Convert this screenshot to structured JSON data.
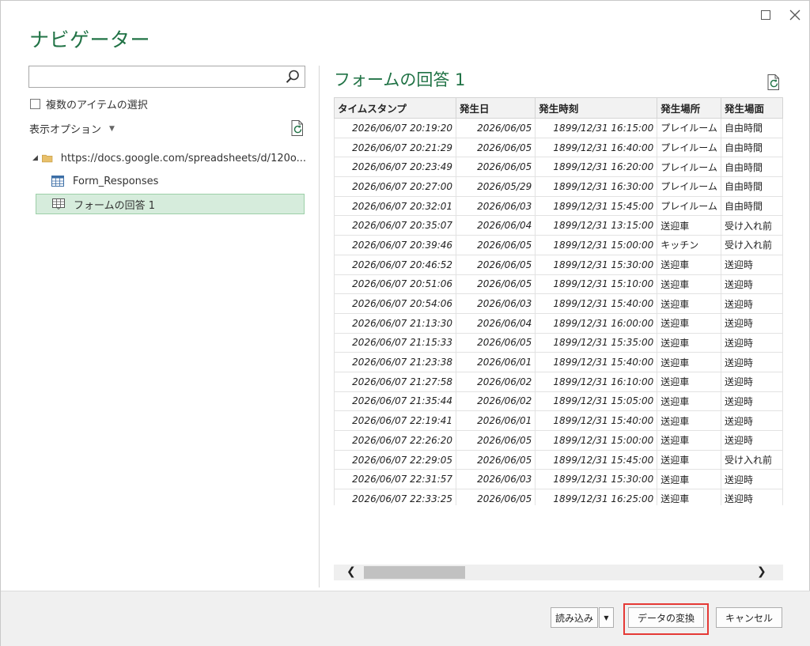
{
  "window": {
    "title": "ナビゲーター"
  },
  "search": {
    "value": "",
    "placeholder": ""
  },
  "left": {
    "multi_select_label": "複数のアイテムの選択",
    "display_options_label": "表示オプション",
    "tree": {
      "root": "https://docs.google.com/spreadsheets/d/120o...",
      "items": [
        {
          "label": "Form_Responses",
          "selected": false
        },
        {
          "label": "フォームの回答 1",
          "selected": true
        }
      ]
    }
  },
  "preview": {
    "title": "フォームの回答 1",
    "columns": [
      "タイムスタンプ",
      "発生日",
      "発生時刻",
      "発生場所",
      "発生場面"
    ],
    "rows": [
      [
        "2026/06/07 20:19:20",
        "2026/06/05",
        "1899/12/31 16:15:00",
        "プレイルーム",
        "自由時間"
      ],
      [
        "2026/06/07 20:21:29",
        "2026/06/05",
        "1899/12/31 16:40:00",
        "プレイルーム",
        "自由時間"
      ],
      [
        "2026/06/07 20:23:49",
        "2026/06/05",
        "1899/12/31 16:20:00",
        "プレイルーム",
        "自由時間"
      ],
      [
        "2026/06/07 20:27:00",
        "2026/05/29",
        "1899/12/31 16:30:00",
        "プレイルーム",
        "自由時間"
      ],
      [
        "2026/06/07 20:32:01",
        "2026/06/03",
        "1899/12/31 15:45:00",
        "プレイルーム",
        "自由時間"
      ],
      [
        "2026/06/07 20:35:07",
        "2026/06/04",
        "1899/12/31 13:15:00",
        "送迎車",
        "受け入れ前"
      ],
      [
        "2026/06/07 20:39:46",
        "2026/06/05",
        "1899/12/31 15:00:00",
        "キッチン",
        "受け入れ前"
      ],
      [
        "2026/06/07 20:46:52",
        "2026/06/05",
        "1899/12/31 15:30:00",
        "送迎車",
        "送迎時"
      ],
      [
        "2026/06/07 20:51:06",
        "2026/06/05",
        "1899/12/31 15:10:00",
        "送迎車",
        "送迎時"
      ],
      [
        "2026/06/07 20:54:06",
        "2026/06/03",
        "1899/12/31 15:40:00",
        "送迎車",
        "送迎時"
      ],
      [
        "2026/06/07 21:13:30",
        "2026/06/04",
        "1899/12/31 16:00:00",
        "送迎車",
        "送迎時"
      ],
      [
        "2026/06/07 21:15:33",
        "2026/06/05",
        "1899/12/31 15:35:00",
        "送迎車",
        "送迎時"
      ],
      [
        "2026/06/07 21:23:38",
        "2026/06/01",
        "1899/12/31 15:40:00",
        "送迎車",
        "送迎時"
      ],
      [
        "2026/06/07 21:27:58",
        "2026/06/02",
        "1899/12/31 16:10:00",
        "送迎車",
        "送迎時"
      ],
      [
        "2026/06/07 21:35:44",
        "2026/06/02",
        "1899/12/31 15:05:00",
        "送迎車",
        "送迎時"
      ],
      [
        "2026/06/07 22:19:41",
        "2026/06/01",
        "1899/12/31 15:40:00",
        "送迎車",
        "送迎時"
      ],
      [
        "2026/06/07 22:26:20",
        "2026/06/05",
        "1899/12/31 15:00:00",
        "送迎車",
        "送迎時"
      ],
      [
        "2026/06/07 22:29:05",
        "2026/06/05",
        "1899/12/31 15:45:00",
        "送迎車",
        "受け入れ前"
      ],
      [
        "2026/06/07 22:31:57",
        "2026/06/03",
        "1899/12/31 15:30:00",
        "送迎車",
        "送迎時"
      ],
      [
        "2026/06/07 22:33:25",
        "2026/06/05",
        "1899/12/31 16:25:00",
        "送迎車",
        "送迎時"
      ]
    ]
  },
  "footer": {
    "load_label": "読み込み",
    "transform_label": "データの変換",
    "cancel_label": "キャンセル"
  },
  "colors": {
    "accent": "#217346",
    "selection": "#d6ecdc",
    "highlight": "#e53935"
  },
  "icons": {
    "search": "search-icon",
    "refresh": "refresh-icon",
    "folder": "folder-icon",
    "table": "table-icon"
  }
}
